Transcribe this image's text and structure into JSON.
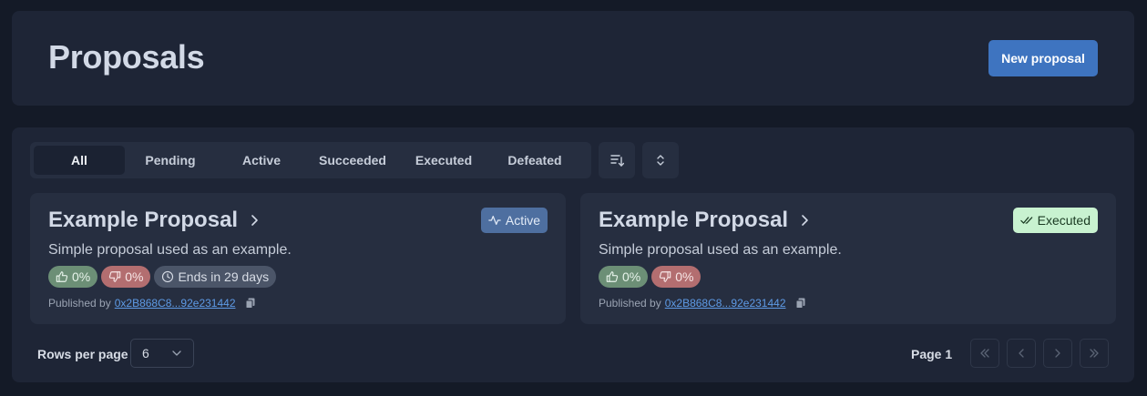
{
  "header": {
    "title": "Proposals",
    "new_button_label": "New proposal"
  },
  "filters": {
    "tabs": [
      "All",
      "Pending",
      "Active",
      "Succeeded",
      "Executed",
      "Defeated"
    ],
    "active_tab": "All",
    "sort_icon": "sort-descending-icon",
    "expand_icon": "chevron-up-down-icon"
  },
  "proposals": [
    {
      "title": "Example Proposal",
      "description": "Simple proposal used as an example.",
      "status": "Active",
      "status_icon": "activity-icon",
      "votes_for": "0%",
      "votes_against": "0%",
      "ends": "Ends in 29 days",
      "published_prefix": "Published by",
      "author": "0x2B868C8...92e231442"
    },
    {
      "title": "Example Proposal",
      "description": "Simple proposal used as an example.",
      "status": "Executed",
      "status_icon": "double-check-icon",
      "votes_for": "0%",
      "votes_against": "0%",
      "published_prefix": "Published by",
      "author": "0x2B868C8...92e231442"
    }
  ],
  "pagination": {
    "rows_label": "Rows per page",
    "rows_value": "6",
    "page_label": "Page 1"
  },
  "colors": {
    "background": "#141a27",
    "card": "#1e2536",
    "accent": "#3e74c0",
    "active_badge": "#4e6fa0",
    "executed_badge": "#c8f2d0",
    "vote_for": "#6c8f76",
    "vote_against": "#b36e70",
    "link": "#5e9be6"
  }
}
